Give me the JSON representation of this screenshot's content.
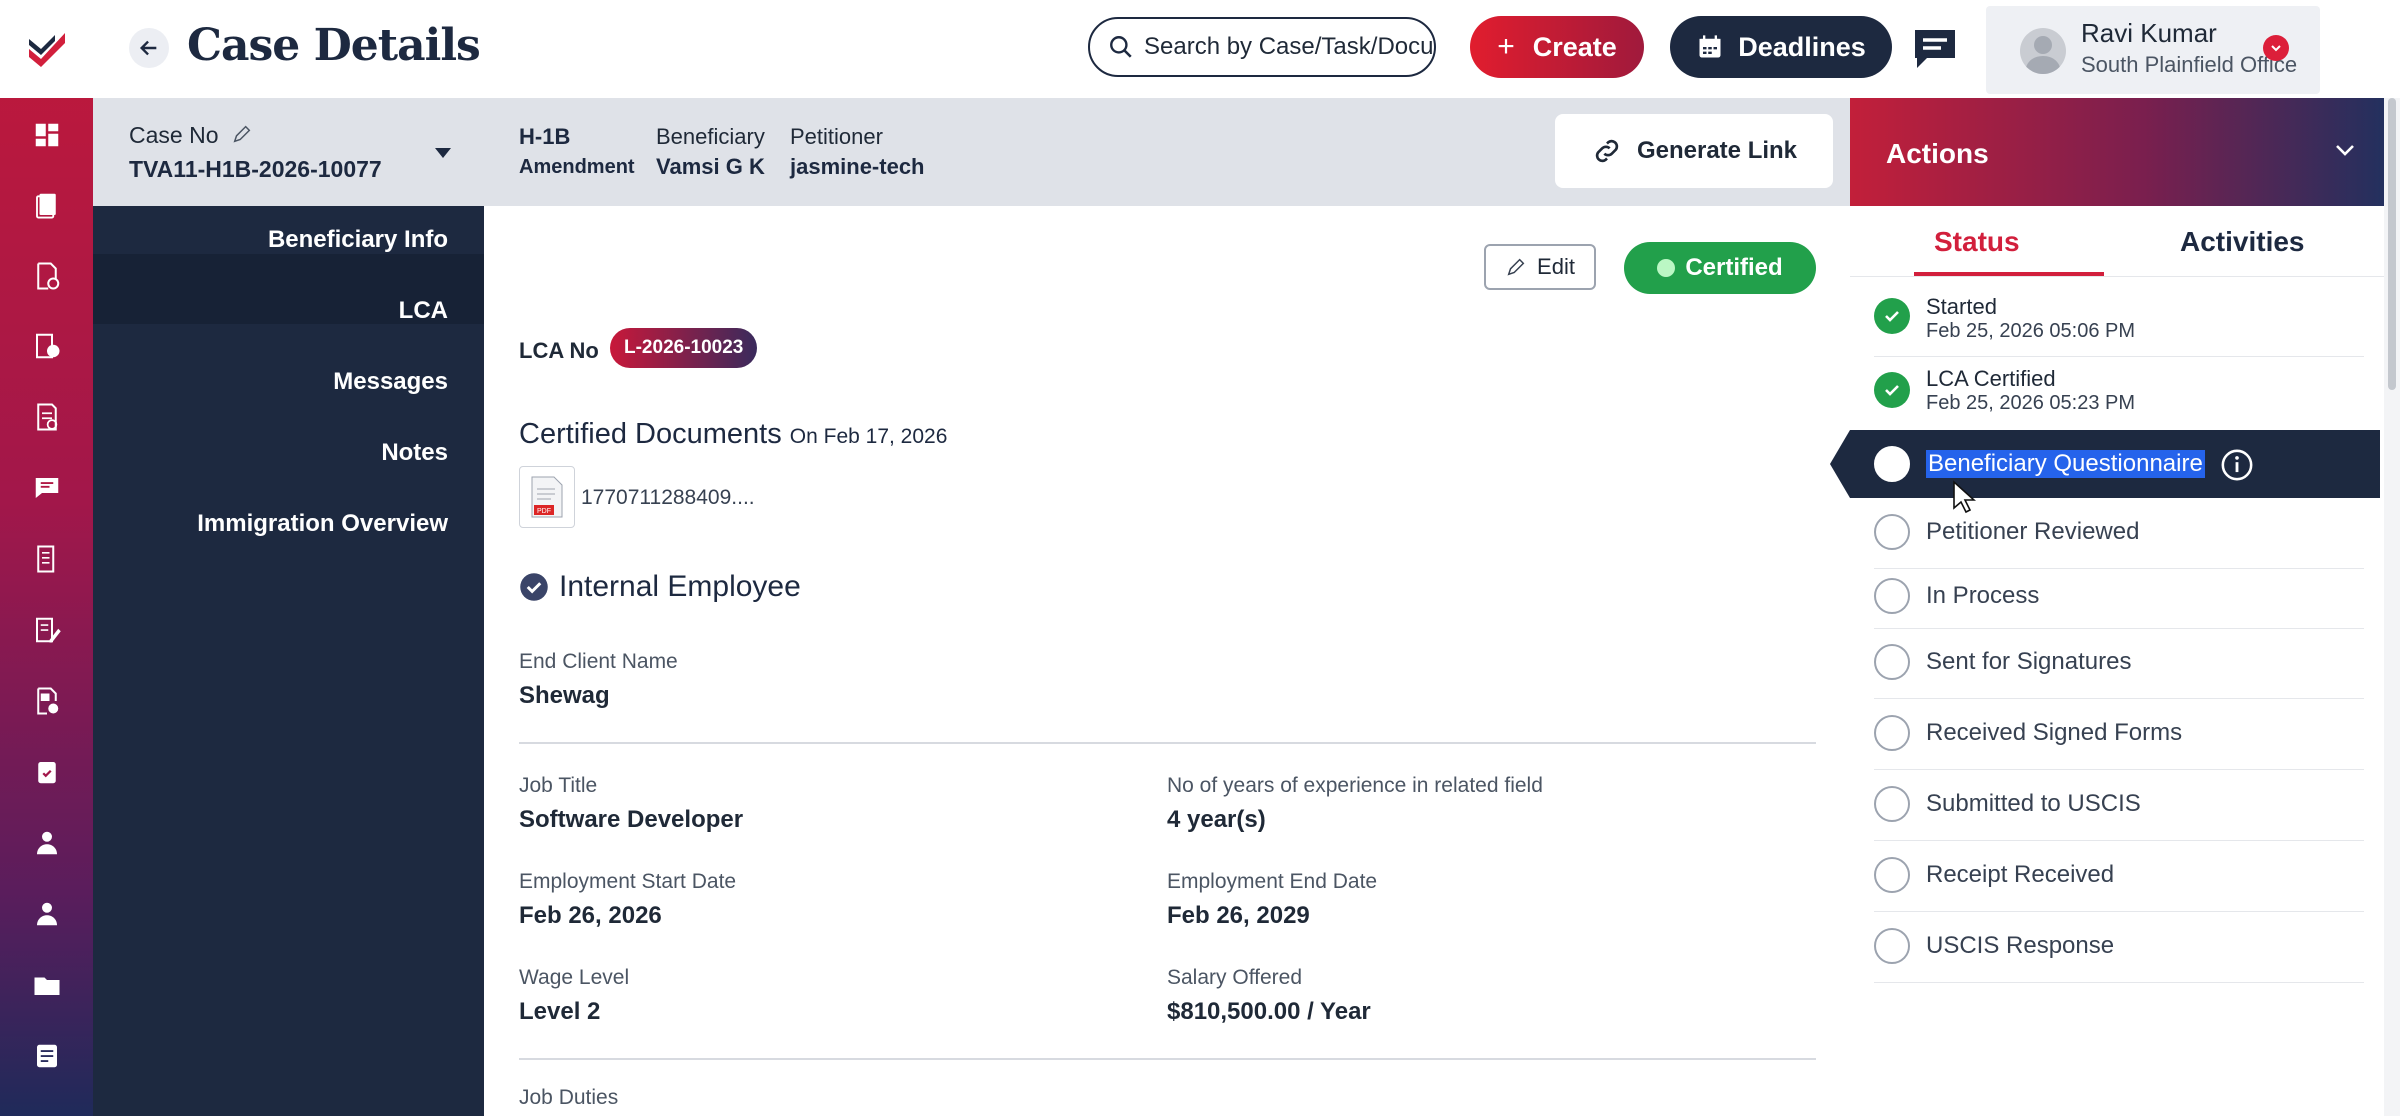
{
  "header": {
    "title": "Case Details",
    "search_placeholder": "Search by Case/Task/Document",
    "create_label": "Create",
    "deadlines_label": "Deadlines",
    "user_name": "Ravi Kumar",
    "user_office": "South Plainfield Office"
  },
  "case_bar": {
    "case_no_label": "Case No",
    "case_no": "TVA11-H1B-2026-10077",
    "visa_type": "H-1B",
    "case_type": "Amendment",
    "beneficiary_label": "Beneficiary",
    "beneficiary": "Vamsi G K",
    "petitioner_label": "Petitioner",
    "petitioner": "jasmine-tech",
    "generate_link_label": "Generate Link"
  },
  "nav": {
    "items": [
      {
        "label": "Beneficiary Info"
      },
      {
        "label": "LCA"
      },
      {
        "label": "Messages"
      },
      {
        "label": "Notes"
      },
      {
        "label": "Immigration Overview"
      }
    ]
  },
  "main": {
    "edit_label": "Edit",
    "status_badge": "Certified",
    "lca_no_label": "LCA No",
    "lca_no": "L-2026-10023",
    "cert_docs_title": "Certified Documents",
    "cert_docs_date": "On Feb 17, 2026",
    "doc_name": "1770711288409....",
    "internal_employee_label": "Internal Employee",
    "end_client_label": "End Client Name",
    "end_client": "Shewag",
    "job_title_label": "Job Title",
    "job_title": "Software Developer",
    "experience_label": "No of years of experience in related field",
    "experience": "4 year(s)",
    "start_label": "Employment Start Date",
    "start_date": "Feb 26, 2026",
    "end_label": "Employment End Date",
    "end_date": "Feb 26, 2029",
    "wage_label": "Wage Level",
    "wage": "Level 2",
    "salary_label": "Salary Offered",
    "salary": "$810,500.00 / Year",
    "job_duties_label": "Job Duties"
  },
  "actions": {
    "title": "Actions",
    "tab_status": "Status",
    "tab_activities": "Activities",
    "statuses": [
      {
        "label": "Started",
        "date": "Feb 25, 2026 05:06 PM",
        "done": true
      },
      {
        "label": "LCA Certified",
        "date": "Feb 25, 2026 05:23 PM",
        "done": true
      },
      {
        "label": "Beneficiary Questionnaire",
        "date": "",
        "done": false
      },
      {
        "label": "Petitioner Reviewed",
        "date": "",
        "done": false
      },
      {
        "label": "In Process",
        "date": "",
        "done": false
      },
      {
        "label": "Sent for Signatures",
        "date": "",
        "done": false
      },
      {
        "label": "Received Signed Forms",
        "date": "",
        "done": false
      },
      {
        "label": "Submitted to USCIS",
        "date": "",
        "done": false
      },
      {
        "label": "Receipt Received",
        "date": "",
        "done": false
      },
      {
        "label": "USCIS Response",
        "date": "",
        "done": false
      }
    ]
  },
  "colors": {
    "brand_red": "#d21f3c",
    "navy": "#1d2940",
    "success_green": "#22a04b"
  },
  "icons": [
    "logo-icon",
    "dashboard-icon",
    "cases-icon",
    "approved-doc-icon",
    "payment-doc-icon",
    "checklist-icon",
    "messages-icon",
    "ledger-icon",
    "notes-icon",
    "doc-lock-icon",
    "clipboard-check-icon",
    "beneficiary-icon",
    "user-icon",
    "folder-icon",
    "form-icon",
    "search-icon",
    "plus-icon",
    "calendar-icon",
    "chat-icon",
    "chevron-down-icon",
    "link-icon",
    "pencil-icon",
    "check-circle-icon",
    "pdf-file-icon",
    "info-icon",
    "back-arrow-icon",
    "cursor-icon"
  ]
}
